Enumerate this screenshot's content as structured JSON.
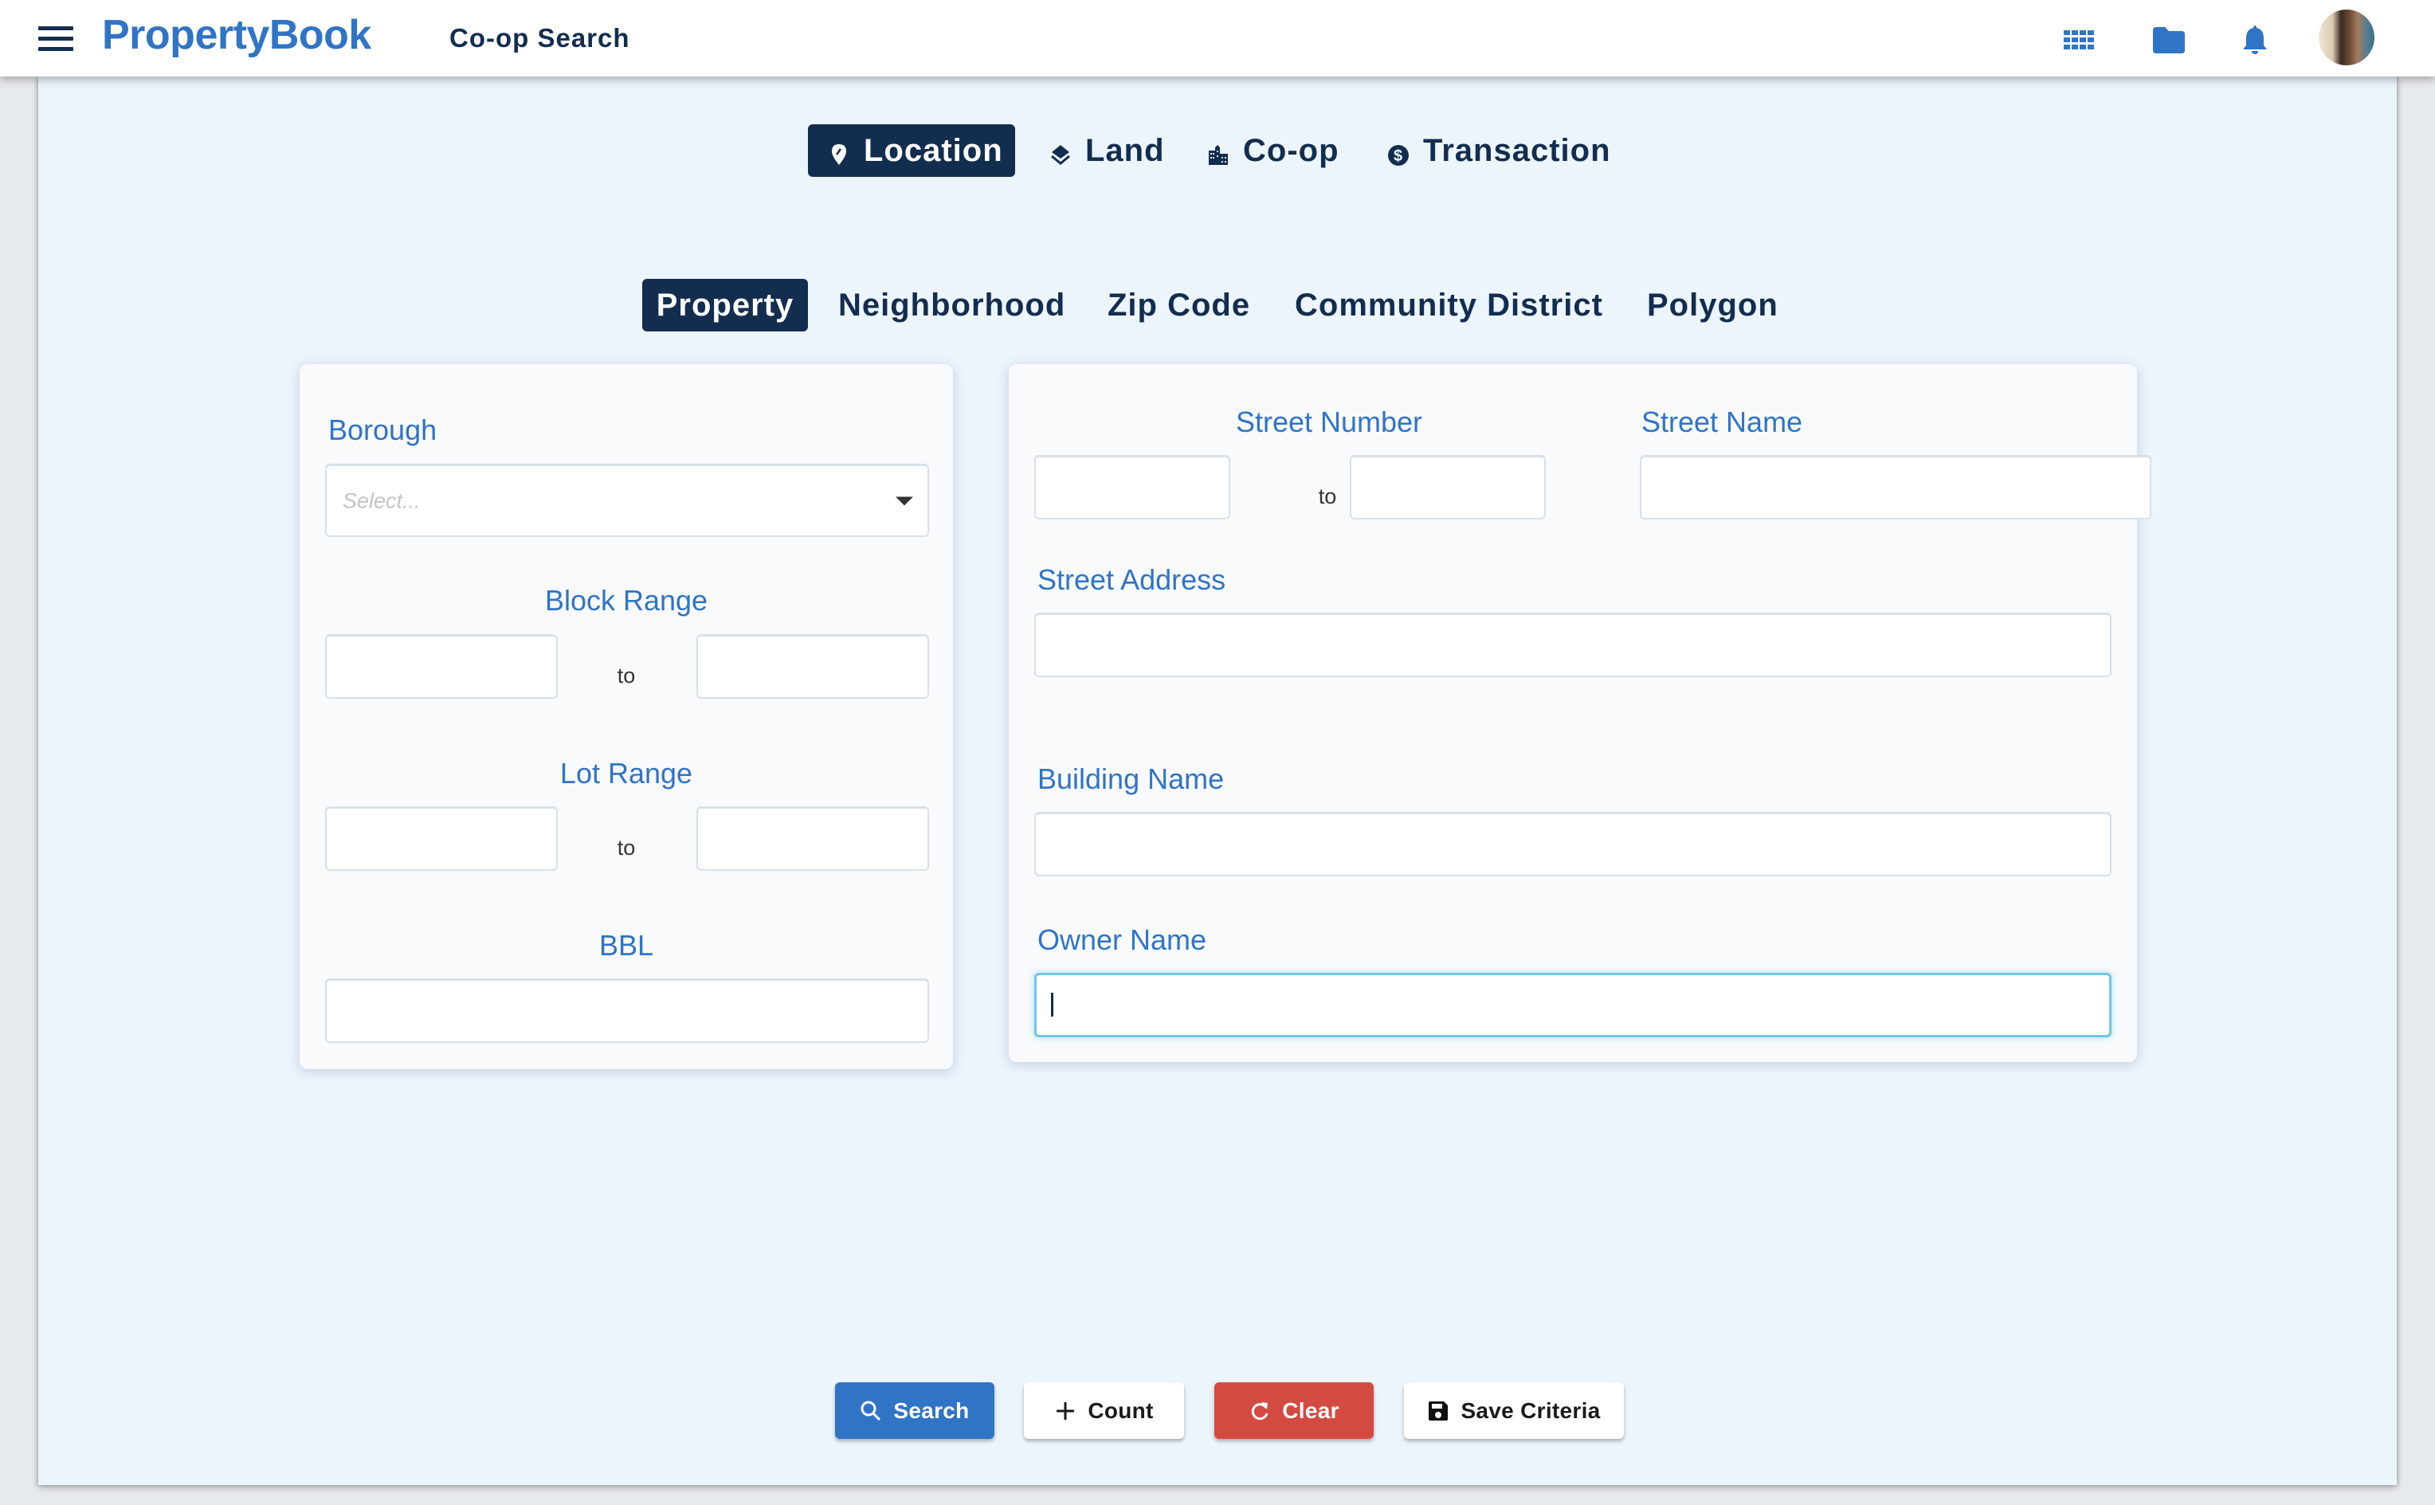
{
  "header": {
    "menu_icon": "hamburger-menu-icon",
    "logo": "PropertyBook",
    "page_title": "Co-op Search",
    "icons": [
      "apps-grid-icon",
      "folder-icon",
      "bell-icon",
      "user-avatar"
    ],
    "accent_color": "#3074C6",
    "navy_color": "#132D4F"
  },
  "top_tabs": [
    {
      "label": "Location",
      "icon": "map-pin-icon",
      "active": true
    },
    {
      "label": "Land",
      "icon": "layers-icon",
      "active": false
    },
    {
      "label": "Co-op",
      "icon": "building-icon",
      "active": false
    },
    {
      "label": "Transaction",
      "icon": "dollar-circle-icon",
      "active": false
    }
  ],
  "sub_tabs": [
    {
      "label": "Property",
      "active": true
    },
    {
      "label": "Neighborhood",
      "active": false
    },
    {
      "label": "Zip Code",
      "active": false
    },
    {
      "label": "Community District",
      "active": false
    },
    {
      "label": "Polygon",
      "active": false
    }
  ],
  "left_card": {
    "borough": {
      "label": "Borough",
      "placeholder": "Select...",
      "value": ""
    },
    "block_range": {
      "label": "Block Range",
      "from": "",
      "to": "",
      "separator": "to"
    },
    "lot_range": {
      "label": "Lot Range",
      "from": "",
      "to": "",
      "separator": "to"
    },
    "bbl": {
      "label": "BBL",
      "value": ""
    }
  },
  "right_card": {
    "street_number": {
      "label": "Street Number",
      "from": "",
      "to": "",
      "separator": "to"
    },
    "street_name": {
      "label": "Street Name",
      "value": ""
    },
    "street_address": {
      "label": "Street Address",
      "value": ""
    },
    "building_name": {
      "label": "Building Name",
      "value": ""
    },
    "owner_name": {
      "label": "Owner Name",
      "value": "",
      "focused": true
    }
  },
  "actions": {
    "search": {
      "label": "Search",
      "icon": "search-icon",
      "color": "#3074C6"
    },
    "count": {
      "label": "Count",
      "icon": "plus-icon"
    },
    "clear": {
      "label": "Clear",
      "icon": "refresh-icon",
      "color": "#D34A40"
    },
    "save": {
      "label": "Save Criteria",
      "icon": "floppy-disk-icon"
    }
  }
}
